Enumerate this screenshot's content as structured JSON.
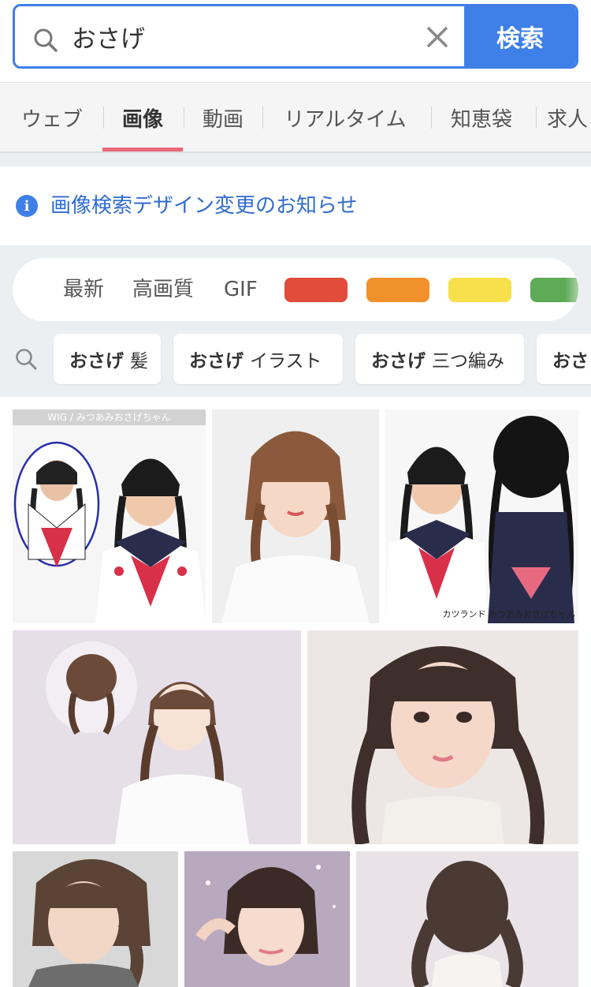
{
  "search": {
    "query": "おさげ",
    "button_label": "検索"
  },
  "tabs": [
    {
      "label": "ウェブ"
    },
    {
      "label": "画像"
    },
    {
      "label": "動画"
    },
    {
      "label": "リアルタイム"
    },
    {
      "label": "知恵袋"
    },
    {
      "label": "求人"
    }
  ],
  "notice": {
    "text": "画像検索デザイン変更のお知らせ"
  },
  "filters": {
    "items": [
      "最新",
      "高画質",
      "GIF"
    ],
    "colors": [
      "#e24c3b",
      "#f0912b",
      "#f7e04b",
      "#5daa57"
    ]
  },
  "suggestions": [
    {
      "bold": "おさげ",
      "rest": "髪"
    },
    {
      "bold": "おさげ",
      "rest": "イラスト"
    },
    {
      "bold": "おさげ",
      "rest": "三つ編み"
    },
    {
      "bold": "おさ",
      "rest": ""
    }
  ],
  "images": {
    "img1_caption": "WIG / みつあみおさげちゃん",
    "img3_caption": "カツランド みつあみおさげちゃん"
  }
}
